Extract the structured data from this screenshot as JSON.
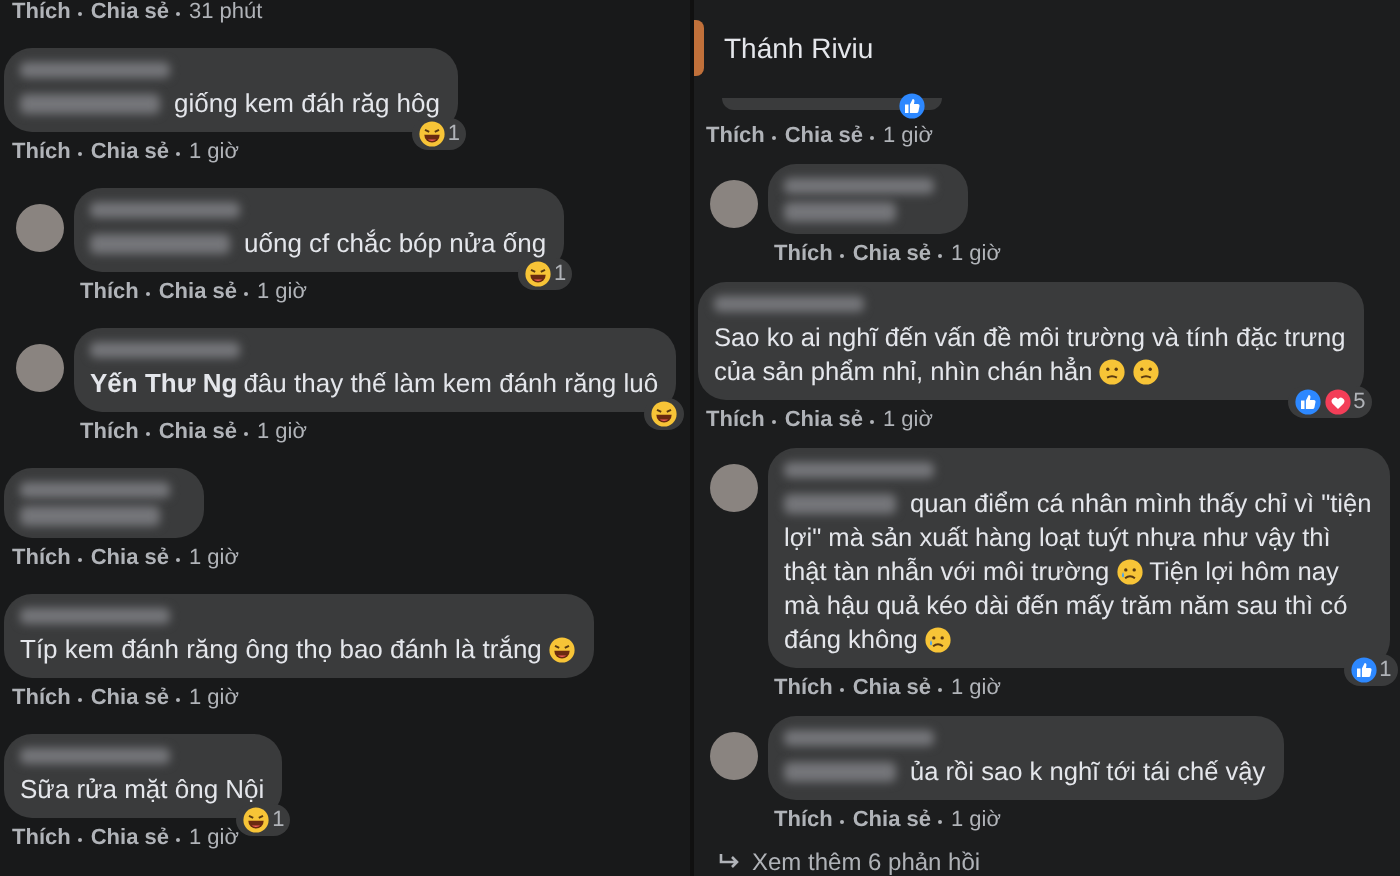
{
  "left_panel": {
    "top_actions": {
      "like": "Thích",
      "share": "Chia sẻ",
      "time": "31 phút"
    },
    "comments": [
      {
        "avatar": false,
        "lines": [
          {
            "pieces": [
              {
                "kind": "blurred_name"
              },
              {
                "kind": "text",
                "text": "giống kem đáh răg hôg"
              }
            ]
          }
        ],
        "reactions": [
          {
            "kind": "haha"
          }
        ],
        "reaction_count": "1",
        "like": "Thích",
        "share": "Chia sẻ",
        "time": "1 giờ"
      },
      {
        "avatar": true,
        "lines": [
          {
            "pieces": [
              {
                "kind": "blurred_name"
              },
              {
                "kind": "text",
                "text": "uống cf chắc bóp nửa ống"
              }
            ]
          }
        ],
        "reactions": [
          {
            "kind": "haha"
          }
        ],
        "reaction_count": "1",
        "like": "Thích",
        "share": "Chia sẻ",
        "time": "1 giờ"
      },
      {
        "avatar": true,
        "mention": "Yến Thư Ng",
        "lines": [
          {
            "pieces": [
              {
                "kind": "text",
                "text": "đâu thay thế làm kem đánh răng luô"
              }
            ]
          }
        ],
        "reactions": [
          {
            "kind": "haha"
          }
        ],
        "like": "Thích",
        "share": "Chia sẻ",
        "time": "1 giờ"
      },
      {
        "avatar": false,
        "lines": [
          {
            "pieces": [
              {
                "kind": "blurred_name"
              }
            ]
          }
        ],
        "like": "Thích",
        "share": "Chia sẻ",
        "time": "1 giờ"
      },
      {
        "avatar": false,
        "lines": [
          {
            "pieces": [
              {
                "kind": "text",
                "text": "Típ kem đánh răng ông thọ bao đánh là trắng"
              },
              {
                "kind": "haha"
              }
            ]
          }
        ],
        "like": "Thích",
        "share": "Chia sẻ",
        "time": "1 giờ"
      },
      {
        "avatar": false,
        "lines": [
          {
            "pieces": [
              {
                "kind": "text",
                "text": "Sữa rửa mặt ông Nội"
              }
            ]
          }
        ],
        "reactions": [
          {
            "kind": "haha"
          }
        ],
        "reaction_count": "1",
        "like": "Thích",
        "share": "Chia sẻ",
        "time": "1 giờ"
      }
    ]
  },
  "right_panel": {
    "page_name": "Thánh Riviu",
    "top_reactions": [
      {
        "kind": "like"
      }
    ],
    "top_actions": {
      "like": "Thích",
      "share": "Chia sẻ",
      "time": "1 giờ"
    },
    "comments": [
      {
        "avatar": true,
        "lines": [
          {
            "pieces": [
              {
                "kind": "blurred_name"
              }
            ]
          }
        ],
        "like": "Thích",
        "share": "Chia sẻ",
        "time": "1 giờ"
      },
      {
        "avatar": false,
        "lines": [
          {
            "pieces": [
              {
                "kind": "text",
                "text": "Sao ko ai nghĩ đến vấn đề môi trường và tính đặc trưng"
              }
            ]
          },
          {
            "pieces": [
              {
                "kind": "text",
                "text": "của sản phẩm nhỉ, nhìn chán hẳn"
              },
              {
                "kind": "confused"
              },
              {
                "kind": "confused"
              }
            ]
          }
        ],
        "reactions": [
          {
            "kind": "like"
          },
          {
            "kind": "love"
          }
        ],
        "reaction_count": "5",
        "like": "Thích",
        "share": "Chia sẻ",
        "time": "1 giờ"
      },
      {
        "avatar": true,
        "lines": [
          {
            "pieces": [
              {
                "kind": "blurred_name"
              },
              {
                "kind": "text",
                "text": "quan điểm cá nhân mình thấy chỉ vì \"tiện"
              }
            ]
          },
          {
            "pieces": [
              {
                "kind": "text",
                "text": "lợi\" mà sản xuất hàng loạt tuýt nhựa như vậy thì"
              }
            ]
          },
          {
            "pieces": [
              {
                "kind": "text",
                "text": "thật tàn nhẫn với môi trường"
              },
              {
                "kind": "sad"
              },
              {
                "kind": "text",
                "text": "Tiện lợi hôm nay"
              }
            ]
          },
          {
            "pieces": [
              {
                "kind": "text",
                "text": "mà hậu quả kéo dài đến mấy trăm năm sau thì có"
              }
            ]
          },
          {
            "pieces": [
              {
                "kind": "text",
                "text": "đáng không"
              },
              {
                "kind": "sad"
              }
            ]
          }
        ],
        "reactions": [
          {
            "kind": "like"
          }
        ],
        "reaction_count": "1",
        "like": "Thích",
        "share": "Chia sẻ",
        "time": "1 giờ"
      },
      {
        "avatar": true,
        "lines": [
          {
            "pieces": [
              {
                "kind": "blurred_name"
              },
              {
                "kind": "text",
                "text": "ủa rồi sao k nghĩ tới tái chế vậy"
              }
            ]
          }
        ],
        "like": "Thích",
        "share": "Chia sẻ",
        "time": "1 giờ"
      }
    ],
    "more_replies": "Xem thêm 6 phản hồi"
  }
}
